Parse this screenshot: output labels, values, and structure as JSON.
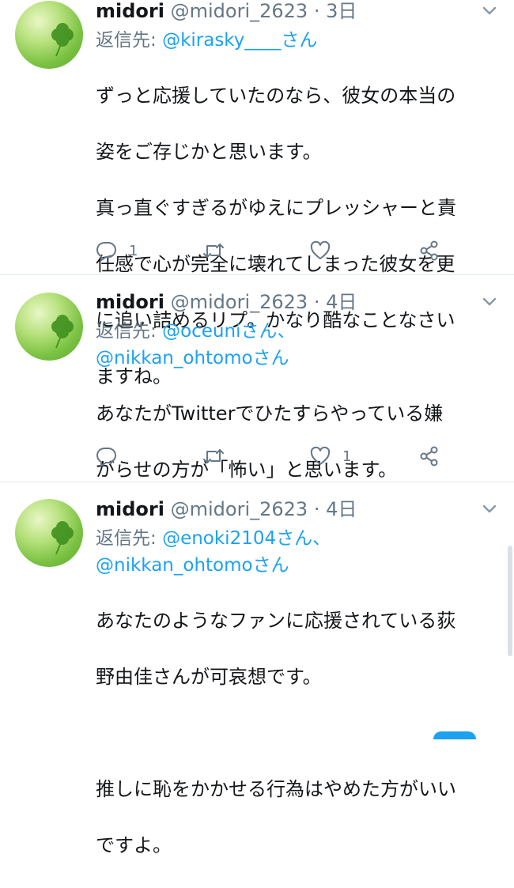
{
  "tweets": [
    {
      "name": "midori",
      "handle": "@midori_2623",
      "time": "· 3日",
      "reply_prefix": "返信先: ",
      "reply_mentions": [
        "@kirasky____さん"
      ],
      "text_lines": [
        "ずっと応援していたのなら、彼女の本当の",
        "姿をご存じかと思います。",
        "真っ直ぐすぎるがゆえにプレッシャーと責",
        "任感で心が完全に壊れてしまった彼女を更",
        "に追い詰めるリプ。かなり酷なことなさい",
        "ますね。"
      ],
      "reply_count": "1",
      "retweet_count": "",
      "like_count": ""
    },
    {
      "name": "midori",
      "handle": "@midori_2623",
      "time": "· 4日",
      "reply_prefix": "返信先: ",
      "reply_mentions": [
        "@oceuniさん、",
        "@nikkan_ohtomoさん"
      ],
      "text_lines": [
        "あなたがTwitterでひたすらやっている嫌",
        "がらせの方が「怖い」と思います。"
      ],
      "reply_count": "",
      "retweet_count": "",
      "like_count": "1"
    },
    {
      "name": "midori",
      "handle": "@midori_2623",
      "time": "· 4日",
      "reply_prefix": "返信先: ",
      "reply_mentions": [
        "@enoki2104さん、",
        "@nikkan_ohtomoさん"
      ],
      "text_lines": [
        "あなたのようなファンに応援されている荻",
        "野由佳さんが可哀想です。",
        "",
        "推しに恥をかかせる行為はやめた方がいい",
        "ですよ。"
      ]
    }
  ],
  "icons": {
    "reply": "reply-icon",
    "retweet": "retweet-icon",
    "like": "heart-icon",
    "share": "share-icon",
    "menu": "chevron-down-icon"
  },
  "colors": {
    "link": "#1da1f2",
    "muted": "#657786",
    "text": "#14171a"
  }
}
